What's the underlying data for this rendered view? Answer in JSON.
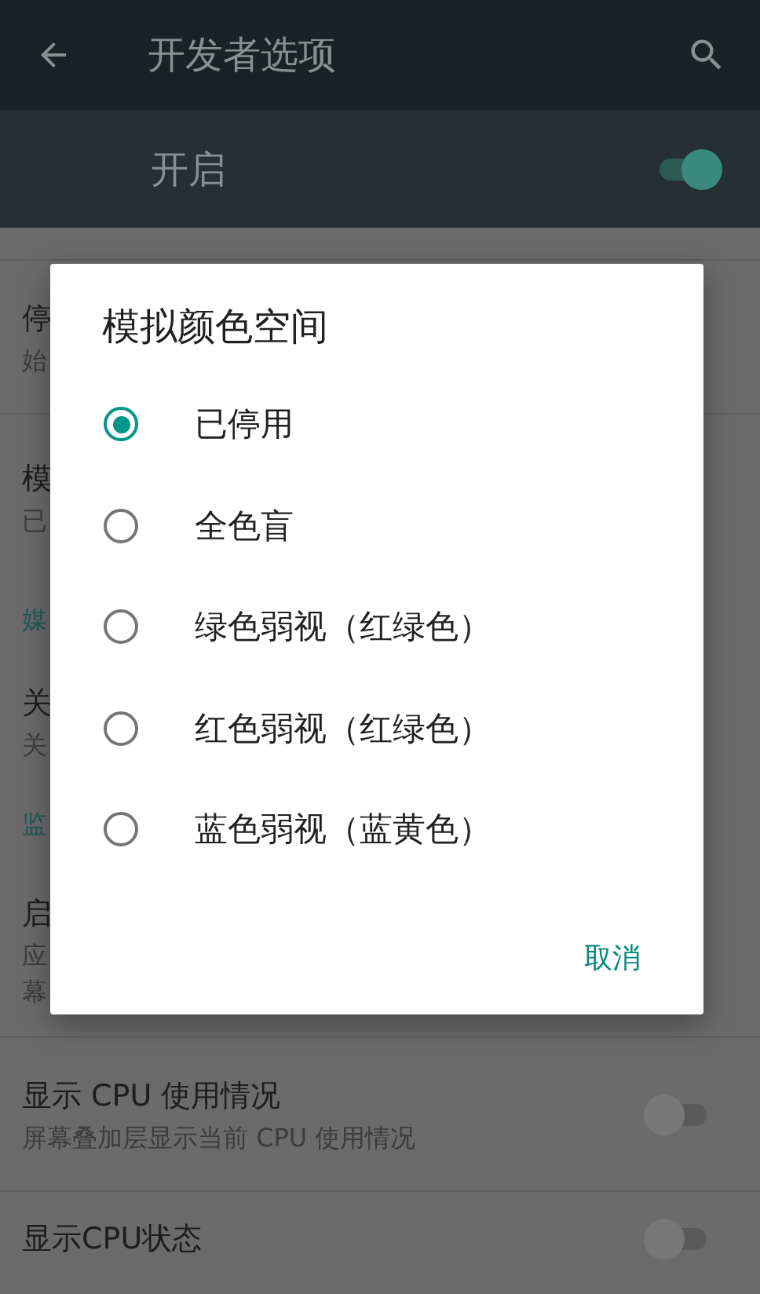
{
  "toolbar": {
    "title": "开发者选项"
  },
  "master_switch": {
    "label": "开启",
    "on": true
  },
  "settings": [
    {
      "kind": "item",
      "title": "停",
      "summary_lines": [
        "始"
      ]
    },
    {
      "kind": "item",
      "title": "模",
      "summary_lines": [
        "已"
      ]
    },
    {
      "kind": "header",
      "title": "媒"
    },
    {
      "kind": "item",
      "title": "关",
      "summary_lines": [
        "关"
      ]
    },
    {
      "kind": "header",
      "title": "监"
    },
    {
      "kind": "item",
      "title": "启",
      "summary_lines": [
        "应",
        "幕"
      ]
    },
    {
      "kind": "switch",
      "title": "显示 CPU 使用情况",
      "summary_lines": [
        "屏幕叠加层显示当前 CPU 使用情况"
      ],
      "on": false
    },
    {
      "kind": "switch",
      "title": "显示CPU状态",
      "on": false
    }
  ],
  "dialog": {
    "title": "模拟颜色空间",
    "options": [
      {
        "label": "已停用",
        "selected": true
      },
      {
        "label": "全色盲",
        "selected": false
      },
      {
        "label": "绿色弱视（红绿色）",
        "selected": false
      },
      {
        "label": "红色弱视（红绿色）",
        "selected": false
      },
      {
        "label": "蓝色弱视（蓝黄色）",
        "selected": false
      }
    ],
    "button": "取消"
  }
}
